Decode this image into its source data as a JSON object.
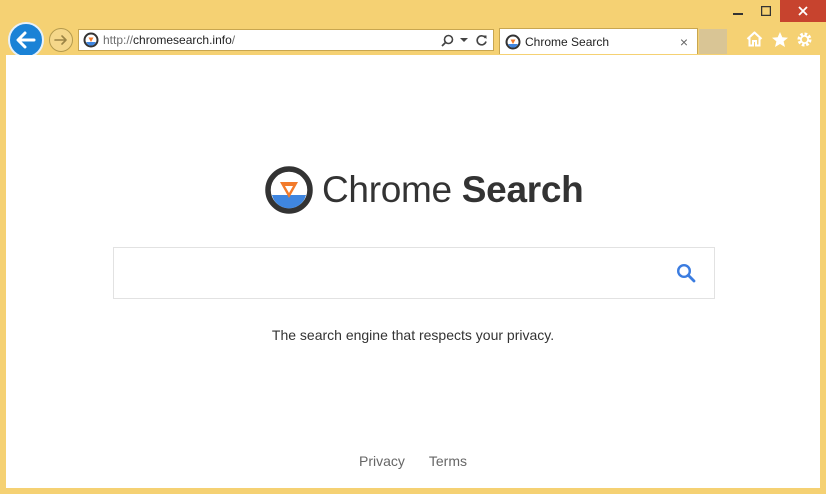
{
  "browser": {
    "url_protocol": "http://",
    "url_host": "chromesearch.info",
    "url_path": "/",
    "tab_title": "Chrome Search",
    "tab_close": "×"
  },
  "page": {
    "logo_text_regular": "Chrome",
    "logo_text_bold": "Search",
    "search_placeholder": "",
    "tagline": "The search engine that respects your privacy.",
    "footer_links": [
      "Privacy",
      "Terms"
    ]
  },
  "icons": {
    "back": "arrow-left-icon",
    "forward": "arrow-right-icon",
    "search": "search-icon",
    "refresh": "refresh-icon",
    "home": "home-icon",
    "favorites": "star-icon",
    "settings": "gear-icon"
  },
  "colors": {
    "frame": "#f5d173",
    "back_button": "#1a82d6",
    "close_button": "#c7432e",
    "search_icon": "#3b7ce0",
    "logo_orange": "#f27a2a",
    "logo_blue": "#3f86e0",
    "logo_dark": "#333333"
  }
}
